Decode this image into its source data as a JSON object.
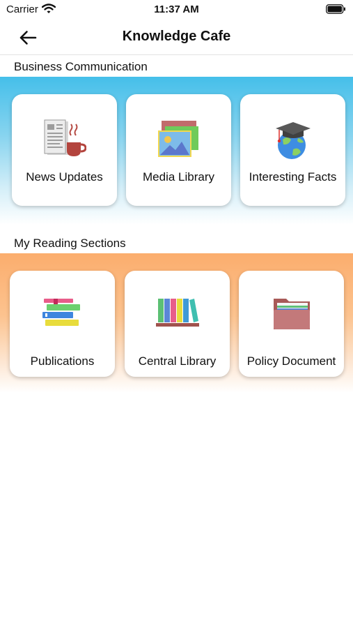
{
  "status_bar": {
    "carrier": "Carrier",
    "time": "11:37 AM"
  },
  "nav": {
    "title": "Knowledge Cafe",
    "back_icon": "arrow-left-icon"
  },
  "sections": [
    {
      "title": "Business Communication",
      "band_color": "#45bfea",
      "items": [
        {
          "label": "News Updates",
          "icon": "newspaper-coffee-icon"
        },
        {
          "label": "Media Library",
          "icon": "image-gallery-icon"
        },
        {
          "label": "Interesting Facts",
          "icon": "globe-graduation-cap-icon"
        }
      ]
    },
    {
      "title": "My Reading Sections",
      "band_color": "#fbad6d",
      "items": [
        {
          "label": "Publications",
          "icon": "book-stack-icon"
        },
        {
          "label": "Central Library",
          "icon": "bookshelf-icon"
        },
        {
          "label": "Policy Document",
          "icon": "folder-icon"
        }
      ]
    }
  ]
}
